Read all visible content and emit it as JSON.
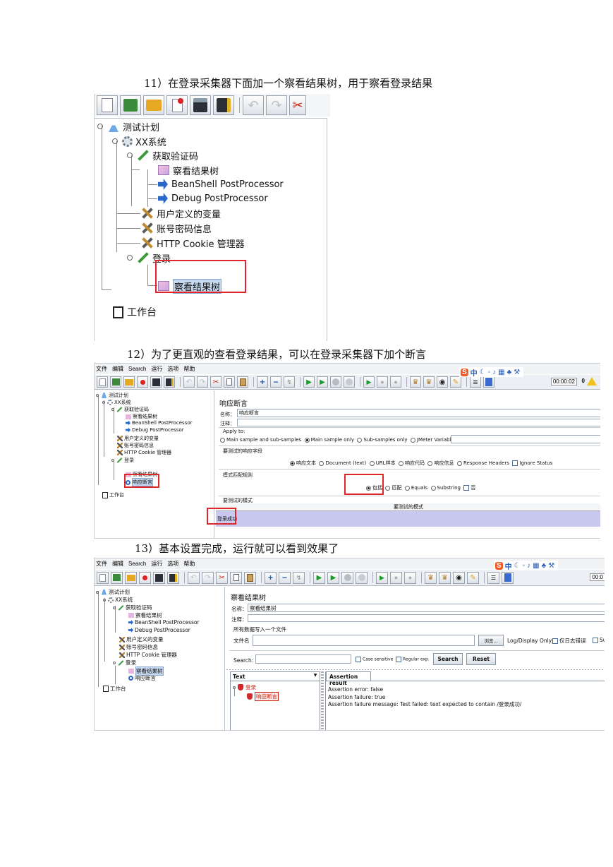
{
  "steps": {
    "s11": "11）在登录采集器下面加一个察看结果树，用于察看登录结果",
    "s12": "12）为了更直观的查看登录结果，可以在登录采集器下加个断言",
    "s13": "13）基本设置完成，运行就可以看到效果了"
  },
  "tree": {
    "plan": "测试计划",
    "xx": "XX系统",
    "captcha": "获取验证码",
    "view_tree": "察看结果树",
    "beanshell": "BeanShell PostProcessor",
    "debug": "Debug PostProcessor",
    "user_vars": "用户定义的变量",
    "account": "账号密码信息",
    "cookie": "HTTP Cookie 管理器",
    "login": "登录",
    "assertion": "响应断言",
    "workbench": "工作台"
  },
  "menu": [
    "文件",
    "编辑",
    "Search",
    "运行",
    "选项",
    "帮助"
  ],
  "timer": "00:00:02",
  "error_count": "0",
  "timer_short": "00:0",
  "ime": {
    "logo": "S",
    "lang": "中"
  },
  "assertion_panel": {
    "title": "响应断言",
    "name_label": "名称：",
    "name_value": "响应断言",
    "comment_label": "注释：",
    "apply_to": "Apply to:",
    "apply_opts": [
      "Main sample and sub-samples",
      "Main sample only",
      "Sub-samples only",
      "JMeter Variable"
    ],
    "field_section": "要测试的响应字段",
    "field_opts": [
      "响应文本",
      "Document (text)",
      "URL样本",
      "响应代码",
      "响应信息",
      "Response Headers"
    ],
    "ignore_status": "Ignore Status",
    "rule_section": "模式匹配规则",
    "rule_opts": [
      "包括",
      "匹配",
      "Equals",
      "Substring"
    ],
    "not": "否",
    "pattern_section": "要测试的模式",
    "pattern_header": "要测试的模式",
    "pattern_value": "登录成功"
  },
  "results_panel": {
    "title": "察看结果树",
    "name_label": "名称：",
    "name_value": "察看结果树",
    "comment_label": "注释：",
    "write_all": "所有数据写入一个文件",
    "file_label": "文件名",
    "browse": "浏览...",
    "log_display": "Log/Display Only:",
    "errors_only": "仅日志错误",
    "successes_short": "Su",
    "search_label": "Search:",
    "case_sensitive": "Case sensitive",
    "regex": "Regular exp.",
    "search_btn": "Search",
    "reset_btn": "Reset",
    "combo_value": "Text",
    "tab": "Assertion result",
    "result_login": "登录",
    "result_assert": "响应断言",
    "lines": [
      "Assertion error: false",
      "Assertion failure: true",
      "Assertion failure message: Test failed: text expected to contain /登录成功/"
    ]
  }
}
